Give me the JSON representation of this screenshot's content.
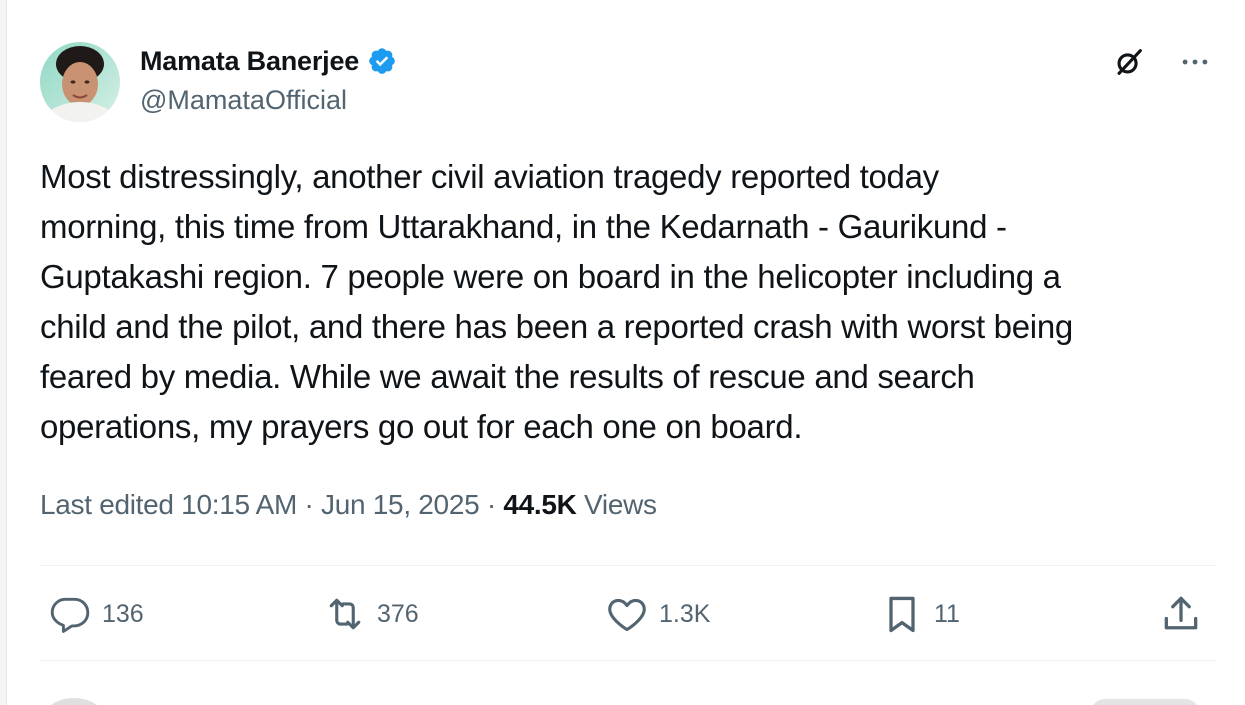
{
  "author": {
    "name": "Mamata Banerjee",
    "handle": "@MamataOfficial",
    "verified_icon": "verified-badge-icon"
  },
  "top_icons": {
    "grok": "grok-icon",
    "more": "more-icon"
  },
  "post": {
    "lines": [
      "Most distressingly, another civil aviation tragedy reported today",
      "morning, this time from Uttarakhand, in the Kedarnath - Gaurikund -",
      "Guptakashi region. 7 people were on board in the helicopter including a",
      "child and the pilot, and there has been a reported crash with worst being",
      "feared by media. While we await the results of rescue and search",
      "operations, my prayers go out for each one on board."
    ],
    "meta": {
      "edited_label": "Last edited 10:15 AM · Jun 15, 2025 · ",
      "views_count": "44.5K",
      "views_label": " Views"
    }
  },
  "actions": {
    "replies": "136",
    "reposts": "376",
    "likes": "1.3K",
    "bookmarks": "11"
  },
  "colors": {
    "text": "#0f1419",
    "muted": "#536471",
    "verified": "#1d9bf0",
    "divider": "#eff3f4"
  }
}
